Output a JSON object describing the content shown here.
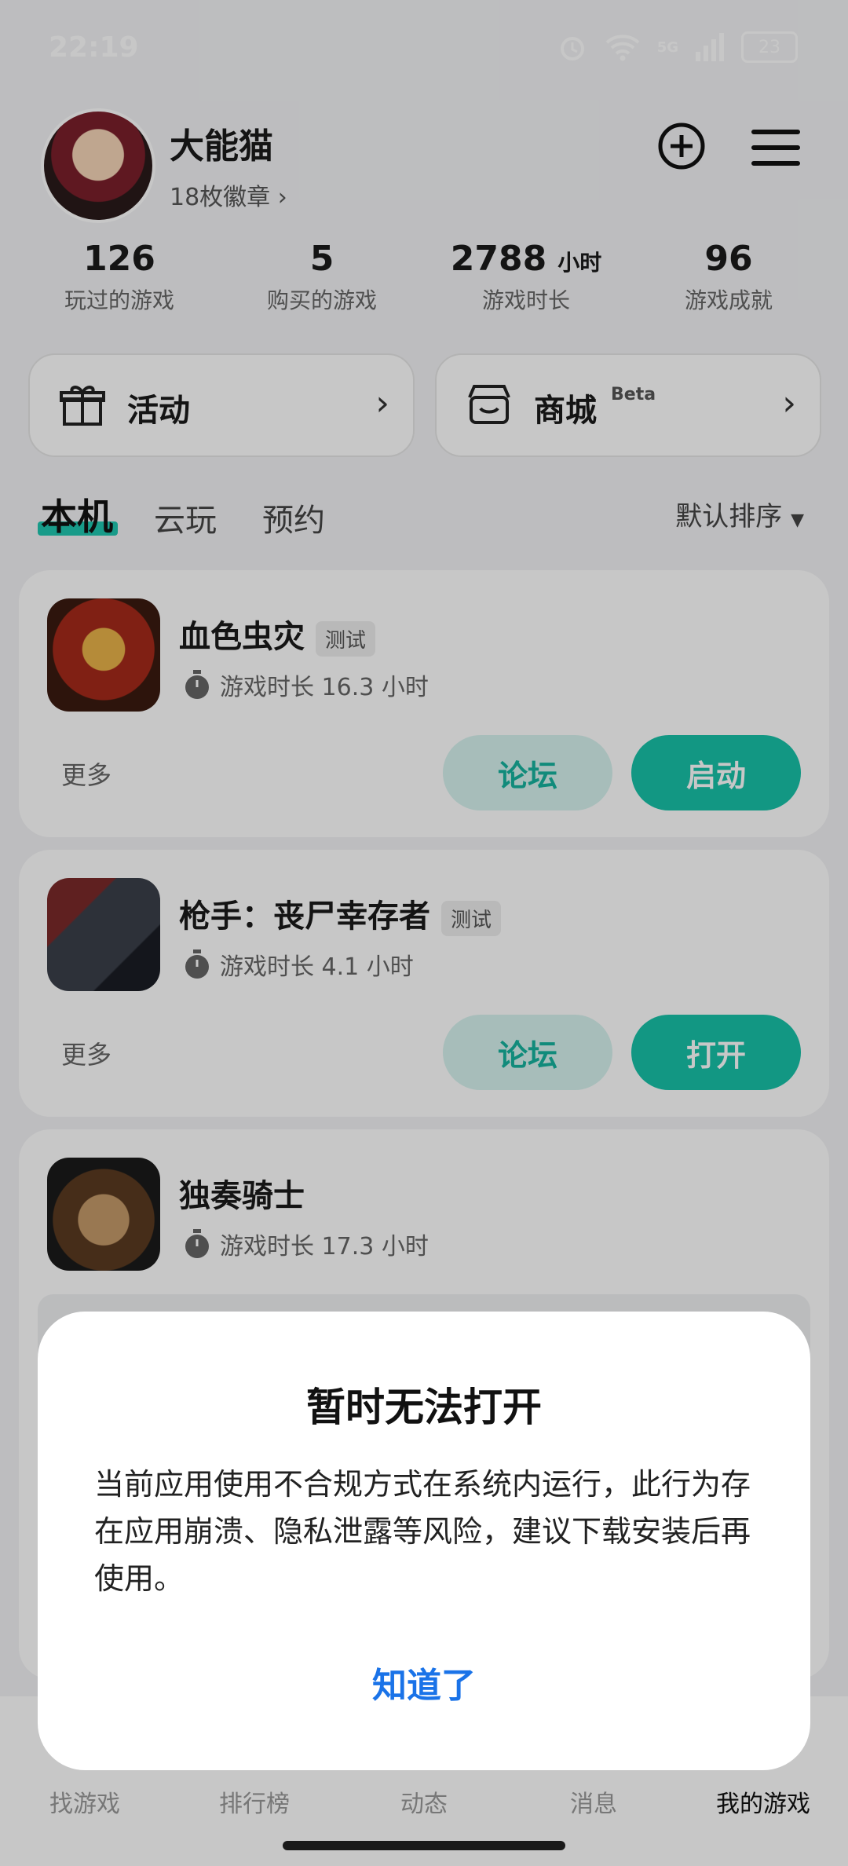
{
  "status": {
    "time": "22:19",
    "battery": "23",
    "network": "5G"
  },
  "profile": {
    "name": "大能猫",
    "badges": "18枚徽章"
  },
  "stats": [
    {
      "value": "126",
      "unit": "",
      "label": "玩过的游戏"
    },
    {
      "value": "5",
      "unit": "",
      "label": "购买的游戏"
    },
    {
      "value": "2788",
      "unit": "小时",
      "label": "游戏时长"
    },
    {
      "value": "96",
      "unit": "",
      "label": "游戏成就"
    }
  ],
  "quick": {
    "activity": "活动",
    "store": "商城",
    "store_tag": "Beta"
  },
  "tabs": {
    "local": "本机",
    "cloud": "云玩",
    "reserve": "预约",
    "sort": "默认排序"
  },
  "games": [
    {
      "title": "血色虫灾",
      "badge": "测试",
      "playtime": "游戏时长 16.3 小时",
      "more": "更多",
      "forum": "论坛",
      "action": "启动"
    },
    {
      "title": "枪手：丧尸幸存者",
      "badge": "测试",
      "playtime": "游戏时长 4.1 小时",
      "more": "更多",
      "forum": "论坛",
      "action": "打开"
    },
    {
      "title": "独奏骑士",
      "playtime": "游戏时长 17.3 小时"
    }
  ],
  "nav": [
    "找游戏",
    "排行榜",
    "动态",
    "消息",
    "我的游戏"
  ],
  "dialog": {
    "title": "暂时无法打开",
    "body": "当前应用使用不合规方式在系统内运行，此行为存在应用崩溃、隐私泄露等风险，建议下载安装后再使用。",
    "ok": "知道了"
  },
  "colors": {
    "accent": "#18c2a8",
    "link": "#1a73e8"
  }
}
